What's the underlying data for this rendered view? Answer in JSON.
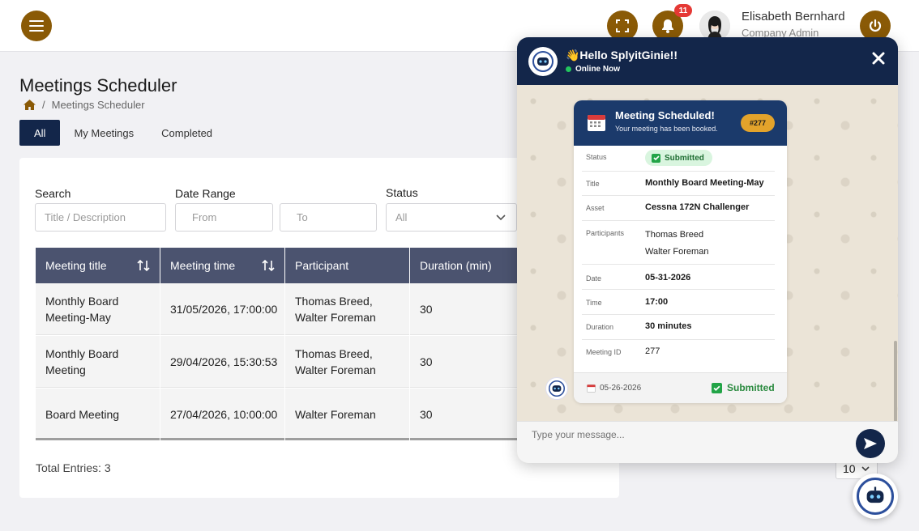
{
  "header": {
    "notifications_count": "11",
    "user_name": "Elisabeth Bernhard",
    "user_role": "Company Admin",
    "brand_color": "#8a5a06"
  },
  "page": {
    "title": "Meetings Scheduler",
    "breadcrumb_current": "Meetings Scheduler"
  },
  "tabs": [
    {
      "label": "All",
      "active": true
    },
    {
      "label": "My Meetings",
      "active": false
    },
    {
      "label": "Completed",
      "active": false
    }
  ],
  "filters": {
    "search_label": "Search",
    "search_placeholder": "Title / Description",
    "date_range_label": "Date Range",
    "from_placeholder": "From",
    "to_placeholder": "To",
    "status_label": "Status",
    "status_value": "All"
  },
  "table": {
    "columns": [
      "Meeting title",
      "Meeting time",
      "Participant",
      "Duration (min)"
    ],
    "rows": [
      {
        "title_line1": "Monthly Board",
        "title_line2": "Meeting-May",
        "time": "31/05/2026, 17:00:00",
        "participant_line1": "Thomas Breed,",
        "participant_line2": "Walter Foreman",
        "duration": "30"
      },
      {
        "title_line1": "Monthly Board",
        "title_line2": "Meeting",
        "time": "29/04/2026, 15:30:53",
        "participant_line1": "Thomas Breed,",
        "participant_line2": "Walter Foreman",
        "duration": "30"
      },
      {
        "title_line1": "Board Meeting",
        "title_line2": "",
        "time": "27/04/2026, 10:00:00",
        "participant_line1": "Walter Foreman",
        "participant_line2": "",
        "duration": "30"
      }
    ],
    "total_entries": "Total Entries: 3",
    "page_size": "10"
  },
  "chat": {
    "greeting": "👋Hello SplyitGinie!!",
    "status": "Online Now",
    "input_placeholder": "Type your message...",
    "card": {
      "title": "Meeting Scheduled!",
      "subtitle": "Your meeting has been booked.",
      "id_badge": "#277",
      "fields": {
        "status_label": "Status",
        "status_value": "Submitted",
        "title_label": "Title",
        "title_value": "Monthly Board Meeting-May",
        "asset_label": "Asset",
        "asset_value": "Cessna 172N Challenger",
        "participants_label": "Participants",
        "participant_1": "Thomas Breed",
        "participant_2": "Walter Foreman",
        "date_label": "Date",
        "date_value": "05-31-2026",
        "time_label": "Time",
        "time_value": "17:00",
        "duration_label": "Duration",
        "duration_value": "30 minutes",
        "meeting_id_label": "Meeting ID",
        "meeting_id_value": "277"
      },
      "footer_date": "05-26-2026",
      "footer_status": "Submitted"
    }
  }
}
